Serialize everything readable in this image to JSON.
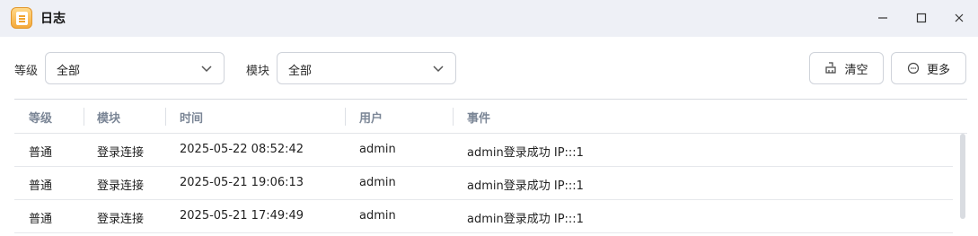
{
  "window": {
    "title": "日志",
    "app_icon": "log-document-icon"
  },
  "filters": {
    "level_label": "等级",
    "level_value": "全部",
    "module_label": "模块",
    "module_value": "全部"
  },
  "actions": {
    "clear_label": "清空",
    "more_label": "更多"
  },
  "table": {
    "headers": [
      "等级",
      "模块",
      "时间",
      "用户",
      "事件"
    ],
    "rows": [
      {
        "level": "普通",
        "module": "登录连接",
        "time": "2025-05-22 08:52:42",
        "user": "admin",
        "event": "admin登录成功 IP:::1"
      },
      {
        "level": "普通",
        "module": "登录连接",
        "time": "2025-05-21 19:06:13",
        "user": "admin",
        "event": "admin登录成功 IP:::1"
      },
      {
        "level": "普通",
        "module": "登录连接",
        "time": "2025-05-21 17:49:49",
        "user": "admin",
        "event": "admin登录成功 IP:::1"
      }
    ]
  }
}
